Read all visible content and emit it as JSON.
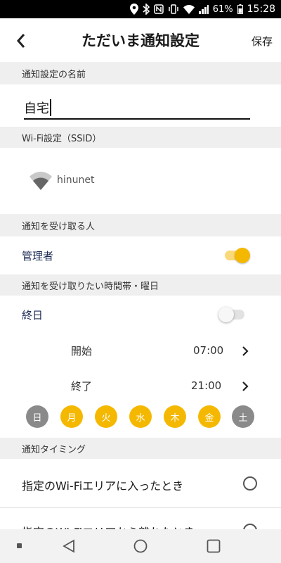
{
  "status_bar": {
    "battery": "61%",
    "time": "15:28"
  },
  "app_bar": {
    "title": "ただいま通知設定",
    "save_label": "保存"
  },
  "sections": {
    "name_header": "通知設定の名前",
    "wifi_header": "Wi-Fi設定（SSID）",
    "receivers_header": "通知を受け取る人",
    "time_header": "通知を受け取りたい時間帯・曜日",
    "timing_header": "通知タイミング"
  },
  "name_field": {
    "value": "自宅"
  },
  "wifi": {
    "ssid": "hinunet"
  },
  "receivers": [
    {
      "label": "管理者",
      "enabled": true
    }
  ],
  "all_day": {
    "label": "終日",
    "enabled": false
  },
  "time_range": {
    "start_label": "開始",
    "start_value": "07:00",
    "end_label": "終了",
    "end_value": "21:00"
  },
  "days": [
    {
      "label": "日",
      "selected": false
    },
    {
      "label": "月",
      "selected": true
    },
    {
      "label": "火",
      "selected": true
    },
    {
      "label": "水",
      "selected": true
    },
    {
      "label": "木",
      "selected": true
    },
    {
      "label": "金",
      "selected": true
    },
    {
      "label": "土",
      "selected": false
    }
  ],
  "timing_options": [
    {
      "label": "指定のWi-Fiエリアに入ったとき",
      "selected": false
    },
    {
      "label": "指定のWi-Fiエリアから離れたとき",
      "selected": false
    }
  ],
  "colors": {
    "accent": "#f5b800",
    "accent_track": "#f9d97a",
    "day_inactive": "#8a8a8a",
    "section_bg": "#efefef"
  }
}
